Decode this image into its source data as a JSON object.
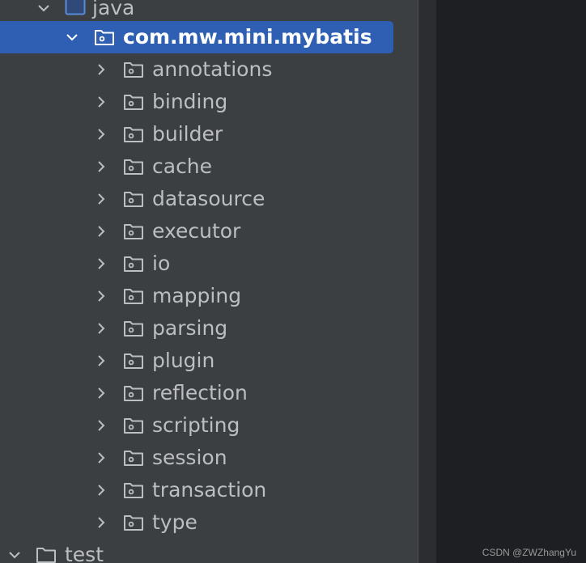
{
  "tree": {
    "parent_folder": "java",
    "selected_package": "com.mw.mini.mybatis",
    "children": [
      "annotations",
      "binding",
      "builder",
      "cache",
      "datasource",
      "executor",
      "io",
      "mapping",
      "parsing",
      "plugin",
      "reflection",
      "scripting",
      "session",
      "transaction",
      "type"
    ],
    "sibling_folder": "test"
  },
  "watermark": "CSDN @ZWZhangYu",
  "colors": {
    "selection": "#2e5fb3",
    "panel": "#3c3f41",
    "text": "#bcbec4"
  }
}
